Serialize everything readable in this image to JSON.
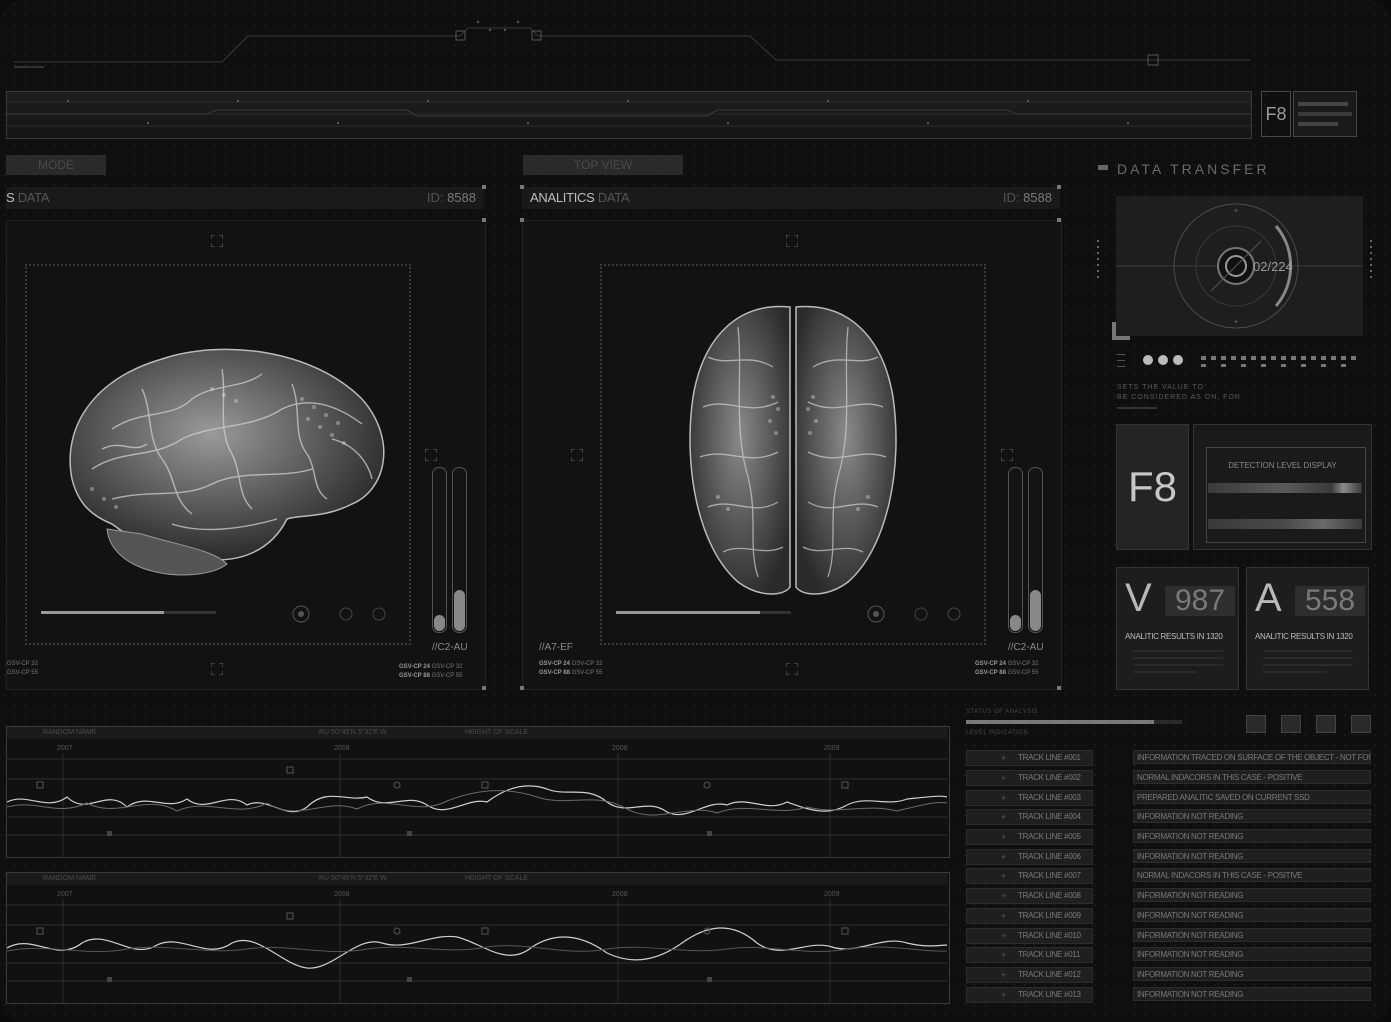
{
  "header": {
    "f8_label": "F8"
  },
  "tabs": {
    "left_tab": "MODE",
    "right_tab": "TOP VIEW"
  },
  "left_panel": {
    "title_bright": "S",
    "title_dim": "DATA",
    "id_label": "ID:",
    "id_value": "8588",
    "tag": "//C2-AU",
    "gsv_left": [
      "GSV-CP 32",
      "GSV-CP 55"
    ],
    "gsv_right_bold": [
      "GSV-CP 24",
      "GSV-CP 88"
    ],
    "gsv_right": [
      "GSV-CP 32",
      "GSV-CP 55"
    ],
    "slider_fill": [
      0.1,
      0.25
    ]
  },
  "right_panel": {
    "title_bright": "ANALITICS",
    "title_dim": "DATA",
    "id_label": "ID:",
    "id_value": "8588",
    "tag_left": "//A7-EF",
    "tag": "//C2-AU",
    "gsv_left_bold": [
      "GSV-CP 24",
      "GSV-CP 88"
    ],
    "gsv_left": [
      "GSV-CP 32",
      "GSV-CP 55"
    ],
    "gsv_right_bold": [
      "GSV-CP 24",
      "GSV-CP 88"
    ],
    "gsv_right": [
      "GSV-CP 32",
      "GSV-CP 55"
    ],
    "slider_fill": [
      0.1,
      0.25
    ]
  },
  "data_transfer": {
    "title": "DATA TRANSFER",
    "counter": "02/224",
    "note_line1": "SETS THE VALUE TO",
    "note_line2": "BE CONSIDERED AS ON, FOR",
    "f8_label": "F8",
    "detection_label": "DETECTION LEVEL DISPLAY"
  },
  "stats": [
    {
      "letter": "V",
      "value": "987",
      "caption": "ANALITIC RESULTS IN 1320"
    },
    {
      "letter": "A",
      "value": "558",
      "caption": "ANALITIC RESULTS IN 1320"
    }
  ],
  "graphs": [
    {
      "h1": "RANDOM NAME",
      "h2": "RU 50°45'N 5°32'E W",
      "h3": "HEIGHT OF SCALE",
      "years": [
        "2007",
        "2008",
        "2008",
        "2009"
      ]
    },
    {
      "h1": "RANDOM NAME",
      "h2": "RU 50°45'N 5°32'E W",
      "h3": "HEIGHT OF SCALE",
      "years": [
        "2007",
        "2008",
        "2008",
        "2009"
      ]
    }
  ],
  "status": {
    "line1": "STATUS OF ANALYSIS",
    "line2": "LEVEL INDICATION",
    "progress": 0.87
  },
  "tracks": [
    "TRACK LINE #001",
    "TRACK LINE #002",
    "TRACK LINE #003",
    "TRACK LINE #004",
    "TRACK LINE #005",
    "TRACK LINE #006",
    "TRACK LINE #007",
    "TRACK LINE #008",
    "TRACK LINE #009",
    "TRACK LINE #010",
    "TRACK LINE #011",
    "TRACK LINE #012",
    "TRACK LINE #013"
  ],
  "infos": [
    "INFORMATION TRACED ON SURFACE OF THE OBJECT - NOT FOUND",
    "NORMAL INDACORS IN THIS CASE - POSITIVE",
    "PREPARED ANALITIC SAVED ON CURRENT SSD",
    "INFORMATION NOT READING",
    "INFORMATION NOT READING",
    "INFORMATION NOT READING",
    "NORMAL INDACORS IN THIS CASE - POSITIVE",
    "INFORMATION NOT READING",
    "INFORMATION NOT READING",
    "INFORMATION NOT READING",
    "INFORMATION NOT READING",
    "INFORMATION NOT READING",
    "INFORMATION NOT READING"
  ]
}
